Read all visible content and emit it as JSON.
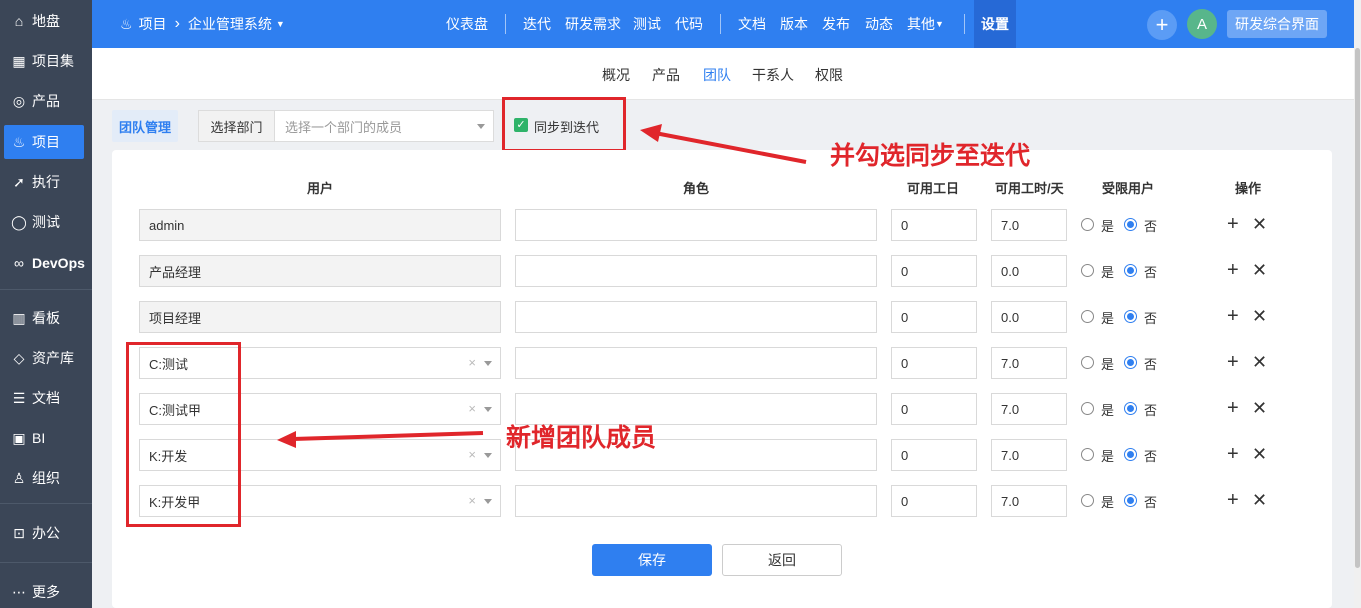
{
  "sidebar": {
    "items": [
      {
        "icon": "home-icon",
        "glyph": "⌂",
        "label": "地盘"
      },
      {
        "icon": "grid-icon",
        "glyph": "▦",
        "label": "项目集"
      },
      {
        "icon": "product-icon",
        "glyph": "◎",
        "label": "产品"
      },
      {
        "icon": "rocket-icon",
        "glyph": "♨",
        "label": "项目"
      },
      {
        "icon": "run-icon",
        "glyph": "➚",
        "label": "执行"
      },
      {
        "icon": "test-icon",
        "glyph": "◯",
        "label": "测试"
      },
      {
        "icon": "infinity-icon",
        "glyph": "∞",
        "label": "DevOps"
      },
      {
        "icon": "kanban-icon",
        "glyph": "▥",
        "label": "看板"
      },
      {
        "icon": "diamond-icon",
        "glyph": "◇",
        "label": "资产库"
      },
      {
        "icon": "doc-icon",
        "glyph": "☰",
        "label": "文档"
      },
      {
        "icon": "bi-icon",
        "glyph": "▣",
        "label": "BI"
      },
      {
        "icon": "org-icon",
        "glyph": "♙",
        "label": "组织"
      },
      {
        "icon": "oa-icon",
        "glyph": "⊡",
        "label": "办公"
      },
      {
        "icon": "more-icon",
        "glyph": "⋯",
        "label": "更多"
      }
    ]
  },
  "header": {
    "crumb_root": "项目",
    "crumb_sep": "›",
    "crumb_current": "企业管理系统",
    "nav": [
      "仪表盘",
      "迭代",
      "研发需求",
      "测试",
      "代码",
      "文档",
      "版本",
      "发布",
      "动态",
      "其他"
    ],
    "settings": "设置",
    "avatar": "A",
    "env_button": "研发综合界面"
  },
  "subtabs": [
    "概况",
    "产品",
    "团队",
    "干系人",
    "权限"
  ],
  "toolbar": {
    "team_mgmt": "团队管理",
    "dept_label": "选择部门",
    "dept_placeholder": "选择一个部门的成员",
    "sync_label": "同步到迭代"
  },
  "table": {
    "headers": [
      "用户",
      "角色",
      "可用工日",
      "可用工时/天",
      "受限用户",
      "操作"
    ],
    "yes": "是",
    "no": "否",
    "rows": [
      {
        "user": "admin",
        "role": "",
        "days": "0",
        "hours": "7.0",
        "editable": false
      },
      {
        "user": "产品经理",
        "role": "",
        "days": "0",
        "hours": "0.0",
        "editable": false
      },
      {
        "user": "项目经理",
        "role": "",
        "days": "0",
        "hours": "0.0",
        "editable": false
      },
      {
        "user": "C:测试",
        "role": "",
        "days": "0",
        "hours": "7.0",
        "editable": true
      },
      {
        "user": "C:测试甲",
        "role": "",
        "days": "0",
        "hours": "7.0",
        "editable": true
      },
      {
        "user": "K:开发",
        "role": "",
        "days": "0",
        "hours": "7.0",
        "editable": true
      },
      {
        "user": "K:开发甲",
        "role": "",
        "days": "0",
        "hours": "7.0",
        "editable": true
      }
    ]
  },
  "buttons": {
    "save": "保存",
    "back": "返回"
  },
  "annotations": {
    "sync_note": "并勾选同步至迭代",
    "members_note": "新增团队成员"
  },
  "colors": {
    "primary": "#2f7ff0",
    "sidebar": "#3b4657",
    "annotation": "#e0262b",
    "check": "#2fb36a"
  }
}
